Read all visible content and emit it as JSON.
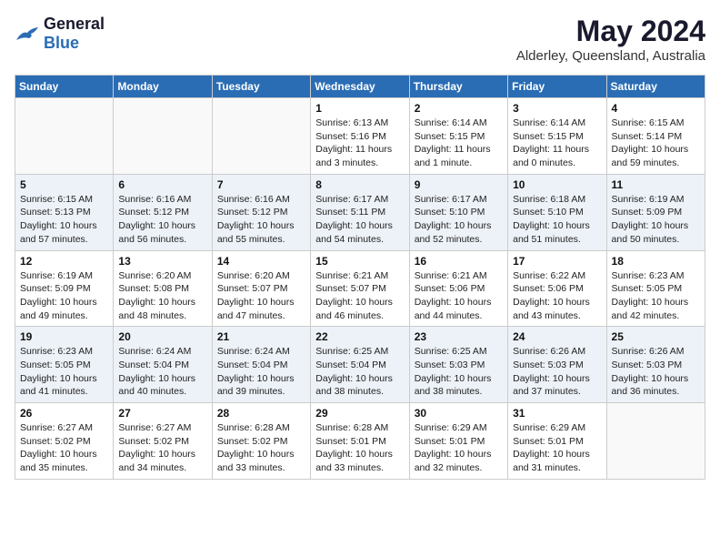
{
  "header": {
    "logo_general": "General",
    "logo_blue": "Blue",
    "title": "May 2024",
    "subtitle": "Alderley, Queensland, Australia"
  },
  "calendar": {
    "days_of_week": [
      "Sunday",
      "Monday",
      "Tuesday",
      "Wednesday",
      "Thursday",
      "Friday",
      "Saturday"
    ],
    "weeks": [
      [
        {
          "day": "",
          "info": ""
        },
        {
          "day": "",
          "info": ""
        },
        {
          "day": "",
          "info": ""
        },
        {
          "day": "1",
          "info": "Sunrise: 6:13 AM\nSunset: 5:16 PM\nDaylight: 11 hours\nand 3 minutes."
        },
        {
          "day": "2",
          "info": "Sunrise: 6:14 AM\nSunset: 5:15 PM\nDaylight: 11 hours\nand 1 minute."
        },
        {
          "day": "3",
          "info": "Sunrise: 6:14 AM\nSunset: 5:15 PM\nDaylight: 11 hours\nand 0 minutes."
        },
        {
          "day": "4",
          "info": "Sunrise: 6:15 AM\nSunset: 5:14 PM\nDaylight: 10 hours\nand 59 minutes."
        }
      ],
      [
        {
          "day": "5",
          "info": "Sunrise: 6:15 AM\nSunset: 5:13 PM\nDaylight: 10 hours\nand 57 minutes."
        },
        {
          "day": "6",
          "info": "Sunrise: 6:16 AM\nSunset: 5:12 PM\nDaylight: 10 hours\nand 56 minutes."
        },
        {
          "day": "7",
          "info": "Sunrise: 6:16 AM\nSunset: 5:12 PM\nDaylight: 10 hours\nand 55 minutes."
        },
        {
          "day": "8",
          "info": "Sunrise: 6:17 AM\nSunset: 5:11 PM\nDaylight: 10 hours\nand 54 minutes."
        },
        {
          "day": "9",
          "info": "Sunrise: 6:17 AM\nSunset: 5:10 PM\nDaylight: 10 hours\nand 52 minutes."
        },
        {
          "day": "10",
          "info": "Sunrise: 6:18 AM\nSunset: 5:10 PM\nDaylight: 10 hours\nand 51 minutes."
        },
        {
          "day": "11",
          "info": "Sunrise: 6:19 AM\nSunset: 5:09 PM\nDaylight: 10 hours\nand 50 minutes."
        }
      ],
      [
        {
          "day": "12",
          "info": "Sunrise: 6:19 AM\nSunset: 5:09 PM\nDaylight: 10 hours\nand 49 minutes."
        },
        {
          "day": "13",
          "info": "Sunrise: 6:20 AM\nSunset: 5:08 PM\nDaylight: 10 hours\nand 48 minutes."
        },
        {
          "day": "14",
          "info": "Sunrise: 6:20 AM\nSunset: 5:07 PM\nDaylight: 10 hours\nand 47 minutes."
        },
        {
          "day": "15",
          "info": "Sunrise: 6:21 AM\nSunset: 5:07 PM\nDaylight: 10 hours\nand 46 minutes."
        },
        {
          "day": "16",
          "info": "Sunrise: 6:21 AM\nSunset: 5:06 PM\nDaylight: 10 hours\nand 44 minutes."
        },
        {
          "day": "17",
          "info": "Sunrise: 6:22 AM\nSunset: 5:06 PM\nDaylight: 10 hours\nand 43 minutes."
        },
        {
          "day": "18",
          "info": "Sunrise: 6:23 AM\nSunset: 5:05 PM\nDaylight: 10 hours\nand 42 minutes."
        }
      ],
      [
        {
          "day": "19",
          "info": "Sunrise: 6:23 AM\nSunset: 5:05 PM\nDaylight: 10 hours\nand 41 minutes."
        },
        {
          "day": "20",
          "info": "Sunrise: 6:24 AM\nSunset: 5:04 PM\nDaylight: 10 hours\nand 40 minutes."
        },
        {
          "day": "21",
          "info": "Sunrise: 6:24 AM\nSunset: 5:04 PM\nDaylight: 10 hours\nand 39 minutes."
        },
        {
          "day": "22",
          "info": "Sunrise: 6:25 AM\nSunset: 5:04 PM\nDaylight: 10 hours\nand 38 minutes."
        },
        {
          "day": "23",
          "info": "Sunrise: 6:25 AM\nSunset: 5:03 PM\nDaylight: 10 hours\nand 38 minutes."
        },
        {
          "day": "24",
          "info": "Sunrise: 6:26 AM\nSunset: 5:03 PM\nDaylight: 10 hours\nand 37 minutes."
        },
        {
          "day": "25",
          "info": "Sunrise: 6:26 AM\nSunset: 5:03 PM\nDaylight: 10 hours\nand 36 minutes."
        }
      ],
      [
        {
          "day": "26",
          "info": "Sunrise: 6:27 AM\nSunset: 5:02 PM\nDaylight: 10 hours\nand 35 minutes."
        },
        {
          "day": "27",
          "info": "Sunrise: 6:27 AM\nSunset: 5:02 PM\nDaylight: 10 hours\nand 34 minutes."
        },
        {
          "day": "28",
          "info": "Sunrise: 6:28 AM\nSunset: 5:02 PM\nDaylight: 10 hours\nand 33 minutes."
        },
        {
          "day": "29",
          "info": "Sunrise: 6:28 AM\nSunset: 5:01 PM\nDaylight: 10 hours\nand 33 minutes."
        },
        {
          "day": "30",
          "info": "Sunrise: 6:29 AM\nSunset: 5:01 PM\nDaylight: 10 hours\nand 32 minutes."
        },
        {
          "day": "31",
          "info": "Sunrise: 6:29 AM\nSunset: 5:01 PM\nDaylight: 10 hours\nand 31 minutes."
        },
        {
          "day": "",
          "info": ""
        }
      ]
    ]
  }
}
